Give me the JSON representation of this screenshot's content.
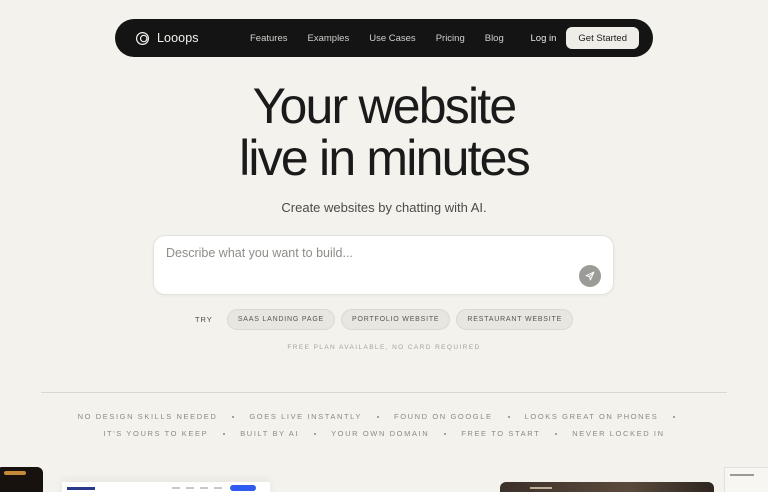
{
  "nav": {
    "brand": "Looops",
    "links": [
      "Features",
      "Examples",
      "Use Cases",
      "Pricing",
      "Blog"
    ],
    "login": "Log in",
    "cta": "Get Started"
  },
  "hero": {
    "title_line1": "Your website",
    "title_line2": "live in minutes",
    "subtitle": "Create websites by chatting with AI."
  },
  "prompt": {
    "placeholder": "Describe what you want to build...",
    "value": "",
    "send_icon": "send-icon"
  },
  "try": {
    "label": "TRY",
    "chips": [
      "SAAS LANDING PAGE",
      "PORTFOLIO WEBSITE",
      "RESTAURANT WEBSITE"
    ]
  },
  "free_note": "FREE PLAN AVAILABLE, NO CARD REQUIRED",
  "features": {
    "row1": [
      "NO DESIGN SKILLS NEEDED",
      "GOES LIVE INSTANTLY",
      "FOUND ON GOOGLE",
      "LOOKS GREAT ON PHONES"
    ],
    "row2": [
      "IT'S YOURS TO KEEP",
      "BUILT BY AI",
      "YOUR OWN DOMAIN",
      "FREE TO START",
      "NEVER LOCKED IN"
    ]
  },
  "colors": {
    "background": "#f3f2ec",
    "nav_bg": "#141414",
    "cta_bg": "#eeede7",
    "send_button": "#9b9b97"
  }
}
